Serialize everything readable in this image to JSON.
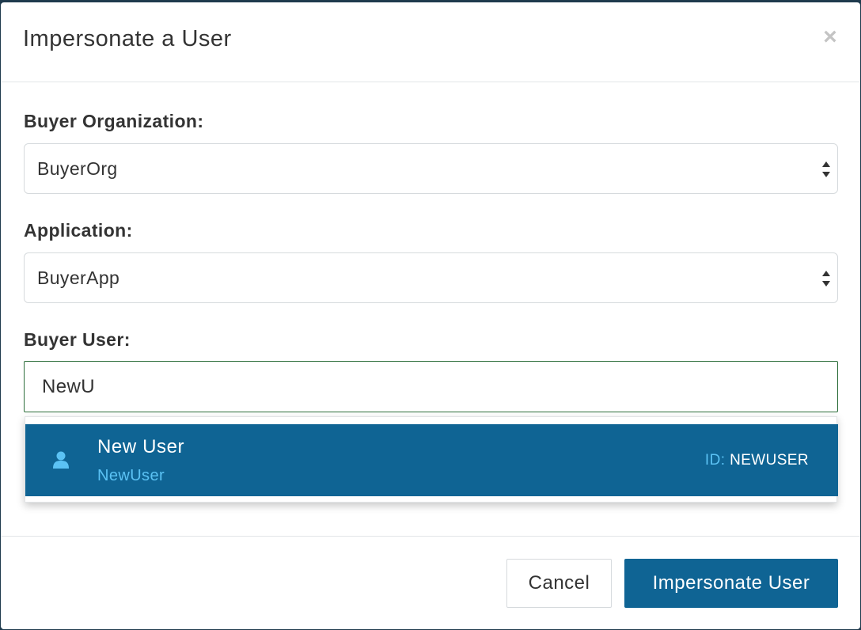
{
  "modal": {
    "title": "Impersonate a User",
    "close_glyph": "×"
  },
  "fields": {
    "buyer_org": {
      "label": "Buyer Organization:",
      "value": "BuyerOrg"
    },
    "application": {
      "label": "Application:",
      "value": "BuyerApp"
    },
    "buyer_user": {
      "label": "Buyer User:",
      "value": "NewU",
      "placeholder": ""
    }
  },
  "suggestions": [
    {
      "name": "New User",
      "username": "NewUser",
      "id_label": "ID:",
      "id_value": "NEWUSER",
      "icon": "user-icon"
    }
  ],
  "footer": {
    "cancel_label": "Cancel",
    "submit_label": "Impersonate User"
  },
  "colors": {
    "primary": "#0f6494",
    "accent_text": "#5bc2f4",
    "input_focus_border": "#2e6f3c"
  }
}
